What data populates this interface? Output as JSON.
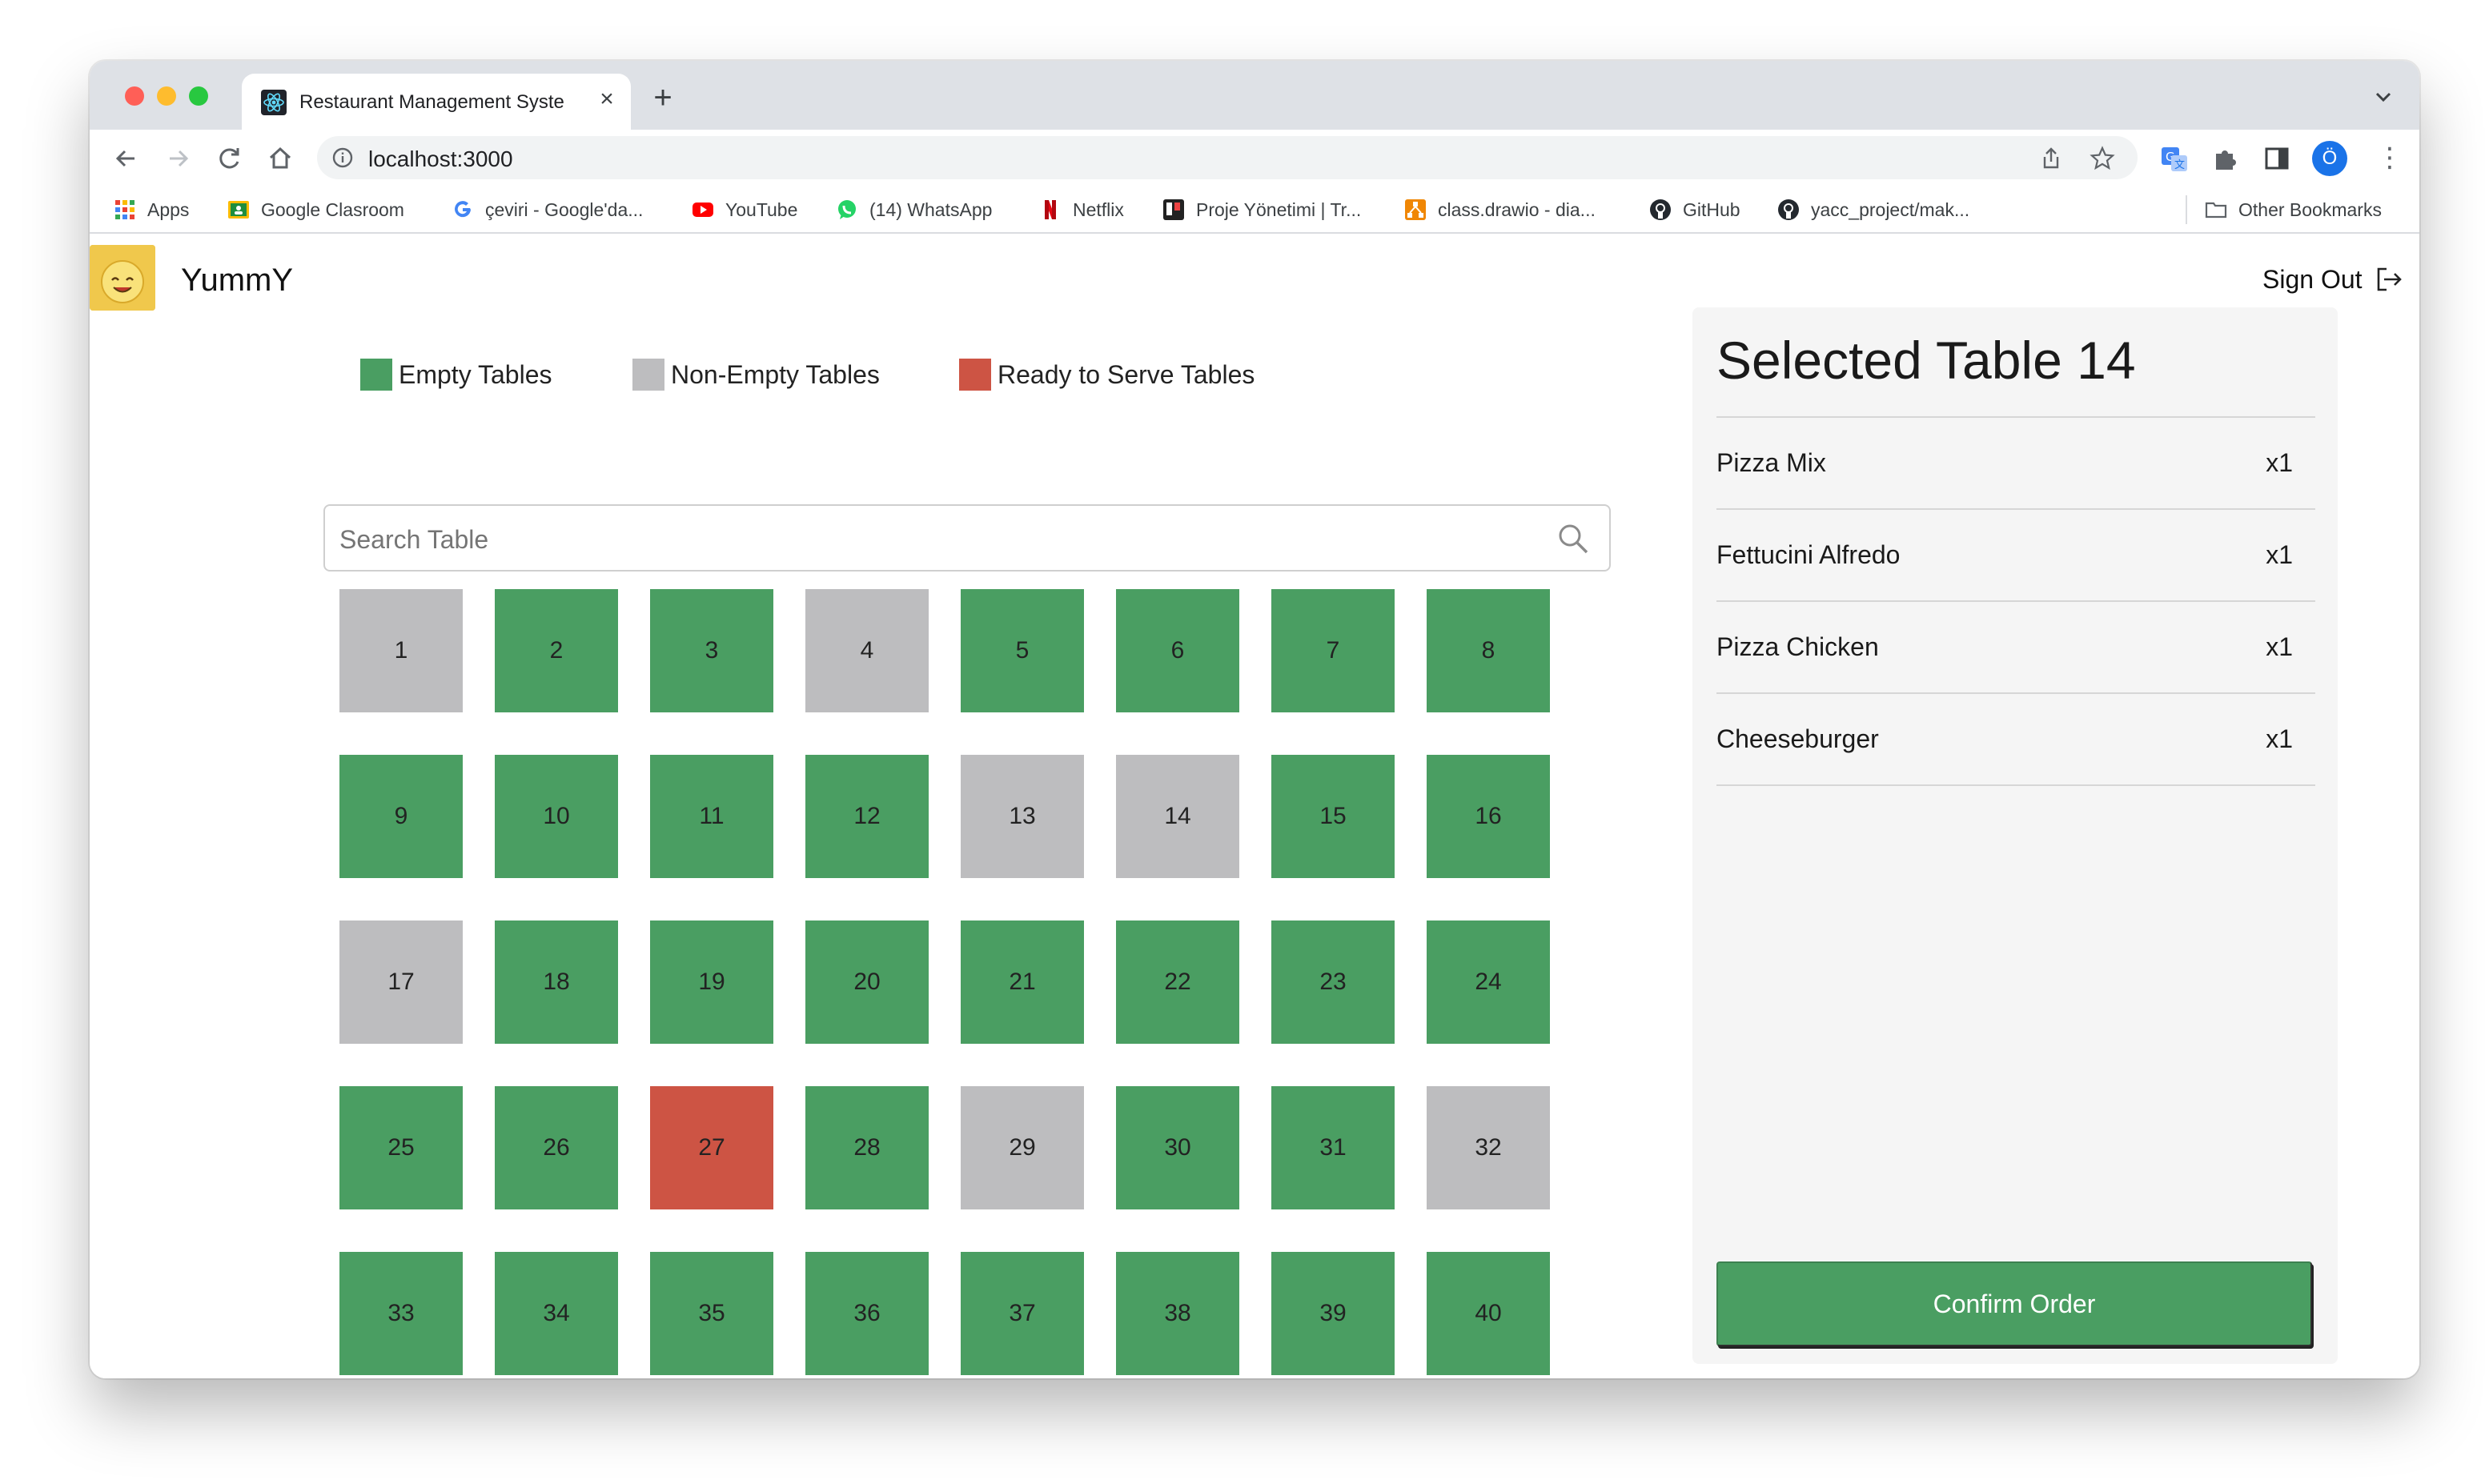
{
  "browser": {
    "tab_title": "Restaurant Management Syste",
    "tab_close": "×",
    "new_tab": "+",
    "url": "localhost:3000",
    "profile_initial": "Ö",
    "menu": "⋮"
  },
  "bookmarks": [
    {
      "label": "Apps",
      "icon": "apps-grid-icon"
    },
    {
      "label": "Google Clasroom",
      "icon": "classroom-icon"
    },
    {
      "label": "çeviri - Google'da...",
      "icon": "google-icon"
    },
    {
      "label": "YouTube",
      "icon": "youtube-icon"
    },
    {
      "label": "(14) WhatsApp",
      "icon": "whatsapp-icon"
    },
    {
      "label": "Netflix",
      "icon": "netflix-icon"
    },
    {
      "label": "Proje Yönetimi | Tr...",
      "icon": "trello-icon"
    },
    {
      "label": "class.drawio - dia...",
      "icon": "drawio-icon"
    },
    {
      "label": "GitHub",
      "icon": "github-icon"
    },
    {
      "label": "yacc_project/mak...",
      "icon": "github-icon"
    },
    {
      "label": "Other Bookmarks",
      "icon": "folder-icon"
    }
  ],
  "app": {
    "name": "YummY",
    "logo_text": "YUMMY",
    "sign_out": "Sign Out"
  },
  "legend": {
    "empty": "Empty Tables",
    "non_empty": "Non-Empty Tables",
    "ready": "Ready to Serve Tables"
  },
  "colors": {
    "empty": "#4a9e62",
    "non_empty": "#bdbdbf",
    "ready": "#cd5444"
  },
  "search": {
    "placeholder": "Search Table"
  },
  "tables": [
    {
      "number": "1",
      "status": "non_empty"
    },
    {
      "number": "2",
      "status": "empty"
    },
    {
      "number": "3",
      "status": "empty"
    },
    {
      "number": "4",
      "status": "non_empty"
    },
    {
      "number": "5",
      "status": "empty"
    },
    {
      "number": "6",
      "status": "empty"
    },
    {
      "number": "7",
      "status": "empty"
    },
    {
      "number": "8",
      "status": "empty"
    },
    {
      "number": "9",
      "status": "empty"
    },
    {
      "number": "10",
      "status": "empty"
    },
    {
      "number": "11",
      "status": "empty"
    },
    {
      "number": "12",
      "status": "empty"
    },
    {
      "number": "13",
      "status": "non_empty"
    },
    {
      "number": "14",
      "status": "non_empty"
    },
    {
      "number": "15",
      "status": "empty"
    },
    {
      "number": "16",
      "status": "empty"
    },
    {
      "number": "17",
      "status": "non_empty"
    },
    {
      "number": "18",
      "status": "empty"
    },
    {
      "number": "19",
      "status": "empty"
    },
    {
      "number": "20",
      "status": "empty"
    },
    {
      "number": "21",
      "status": "empty"
    },
    {
      "number": "22",
      "status": "empty"
    },
    {
      "number": "23",
      "status": "empty"
    },
    {
      "number": "24",
      "status": "empty"
    },
    {
      "number": "25",
      "status": "empty"
    },
    {
      "number": "26",
      "status": "empty"
    },
    {
      "number": "27",
      "status": "ready"
    },
    {
      "number": "28",
      "status": "empty"
    },
    {
      "number": "29",
      "status": "non_empty"
    },
    {
      "number": "30",
      "status": "empty"
    },
    {
      "number": "31",
      "status": "empty"
    },
    {
      "number": "32",
      "status": "non_empty"
    },
    {
      "number": "33",
      "status": "empty"
    },
    {
      "number": "34",
      "status": "empty"
    },
    {
      "number": "35",
      "status": "empty"
    },
    {
      "number": "36",
      "status": "empty"
    },
    {
      "number": "37",
      "status": "empty"
    },
    {
      "number": "38",
      "status": "empty"
    },
    {
      "number": "39",
      "status": "empty"
    },
    {
      "number": "40",
      "status": "empty"
    },
    {
      "number": "",
      "status": "empty"
    },
    {
      "number": "",
      "status": "empty"
    },
    {
      "number": "",
      "status": "empty"
    },
    {
      "number": "",
      "status": "empty"
    },
    {
      "number": "",
      "status": "empty"
    },
    {
      "number": "",
      "status": "empty"
    },
    {
      "number": "",
      "status": "empty"
    },
    {
      "number": "",
      "status": "empty"
    }
  ],
  "selected": {
    "title": "Selected Table 14",
    "items": [
      {
        "name": "Pizza Mix",
        "qty": "x1"
      },
      {
        "name": "Fettucini Alfredo",
        "qty": "x1"
      },
      {
        "name": "Pizza Chicken",
        "qty": "x1"
      },
      {
        "name": "Cheeseburger",
        "qty": "x1"
      }
    ],
    "confirm_label": "Confirm Order"
  }
}
